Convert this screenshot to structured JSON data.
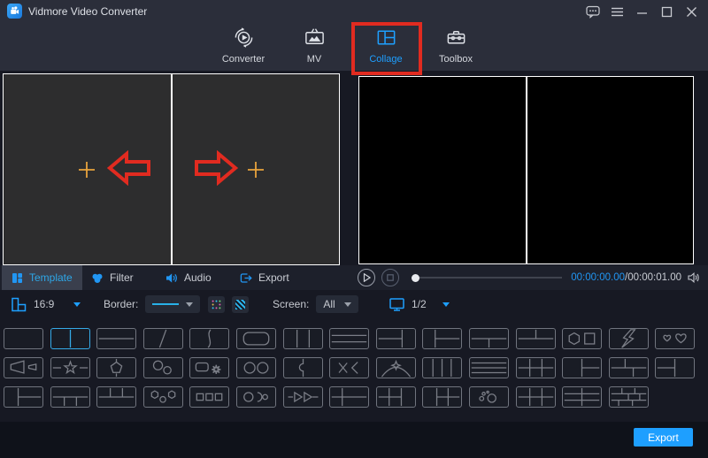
{
  "window": {
    "title": "Vidmore Video Converter"
  },
  "titlebar_controls": [
    {
      "name": "feedback",
      "icon": "feedback-bubble-icon"
    },
    {
      "name": "menu",
      "icon": "hamburger-menu-icon"
    },
    {
      "name": "minimize",
      "icon": "minimize-icon"
    },
    {
      "name": "maximize",
      "icon": "maximize-icon"
    },
    {
      "name": "close",
      "icon": "close-icon"
    }
  ],
  "nav": {
    "items": [
      {
        "label": "Converter",
        "icon": "converter-icon",
        "active": false
      },
      {
        "label": "MV",
        "icon": "mv-icon",
        "active": false
      },
      {
        "label": "Collage",
        "icon": "collage-icon",
        "active": true,
        "annotated": true
      },
      {
        "label": "Toolbox",
        "icon": "toolbox-icon",
        "active": false
      }
    ]
  },
  "collage_editor": {
    "cells": [
      {
        "action": "add-video",
        "icon": "plus-icon",
        "annotation": "red-arrow-pointing-left"
      },
      {
        "action": "add-video",
        "icon": "plus-icon",
        "annotation": "red-arrow-pointing-right"
      }
    ]
  },
  "tabs": [
    {
      "label": "Template",
      "icon": "template-icon",
      "active": true
    },
    {
      "label": "Filter",
      "icon": "filter-icon",
      "active": false
    },
    {
      "label": "Audio",
      "icon": "audio-icon",
      "active": false
    },
    {
      "label": "Export",
      "icon": "export-icon",
      "active": false
    }
  ],
  "player": {
    "current_time": "00:00:00.00",
    "separator": "/",
    "duration": "00:00:01.00"
  },
  "toolbar": {
    "aspect_ratio": "16:9",
    "border_label": "Border:",
    "screen_label": "Screen:",
    "screen_value": "All",
    "page": "1/2"
  },
  "templates": {
    "selected_row": 0,
    "selected_index": 1,
    "rows": [
      [
        "single",
        "split-2-cols",
        "split-2-rows",
        "diagonal-split",
        "curve-split",
        "rounded-inset",
        "split-3-cols",
        "split-3-rows",
        "left-2rows-right-col",
        "left-col-right-2rows-narrow",
        "top-full-bottom-2",
        "top-2-bottom-full",
        "hexagon-square",
        "lightning-split",
        "two-hearts"
      ],
      [
        "megaphones",
        "star-on-line",
        "pentagon-on-line",
        "two-circles-diagonal",
        "frame-and-burst",
        "two-circles",
        "puzzle-split",
        "cross-and-bracket",
        "arch-and-clover",
        "split-4-cols",
        "split-4-rows",
        "grid-2x3",
        "left-col-right-2rows",
        "offset-grid-4",
        "left-2rows-right-col-b"
      ],
      [
        "left-col-right-2rows-c",
        "top-full-bottom-3",
        "top-3-bottom-full",
        "hex-circle-hex",
        "three-squares",
        "circle-semicircles",
        "two-arrows",
        "left-col-cross",
        "grid-2x2-right-col",
        "left-col-grid-2x2",
        "dots-and-circle",
        "grid-2x3-b",
        "grid-2cols-3rows",
        "mosaic-grid"
      ]
    ]
  },
  "footer": {
    "export_label": "Export"
  },
  "colors": {
    "accent_blue": "#1e9fff",
    "annotation_red": "#e12b20",
    "plus_orange": "#e8a33d",
    "selected_template": "#35aae8",
    "time_current": "#2196f3"
  }
}
